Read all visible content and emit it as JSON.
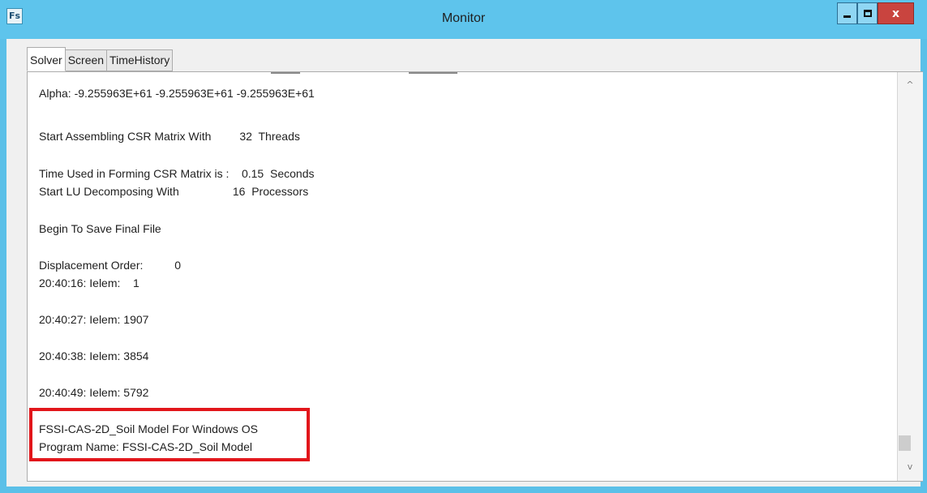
{
  "window": {
    "title": "Monitor",
    "icon_text": "Fs",
    "controls": {
      "minimize": "minimize",
      "maximize": "maximize",
      "close": "x"
    }
  },
  "tabs": [
    {
      "label": "Solver",
      "active": true
    },
    {
      "label": "Screen",
      "active": false
    },
    {
      "label": "TimeHistory",
      "active": false
    }
  ],
  "log": {
    "lines": [
      "Alpha: -9.255963E+61 -9.255963E+61 -9.255963E+61",
      "Start Assembling CSR Matrix With         32  Threads",
      "Time Used in Forming CSR Matrix is :    0.15  Seconds",
      "Start LU Decomposing With                 16  Processors",
      "Begin To Save Final File",
      "Displacement Order:          0",
      "20:40:16: Ielem:    1",
      "20:40:27: Ielem: 1907",
      "20:40:38: Ielem: 3854",
      "20:40:49: Ielem: 5792",
      "FSSI-CAS-2D_Soil Model For Windows OS",
      "Program Name: FSSI-CAS-2D_Soil Model"
    ]
  },
  "scrollbar": {
    "up_arrow": "^",
    "down_arrow": "v"
  },
  "colors": {
    "titlebar": "#5ec4ec",
    "close_button": "#c9443f",
    "highlight": "#e2161b"
  }
}
